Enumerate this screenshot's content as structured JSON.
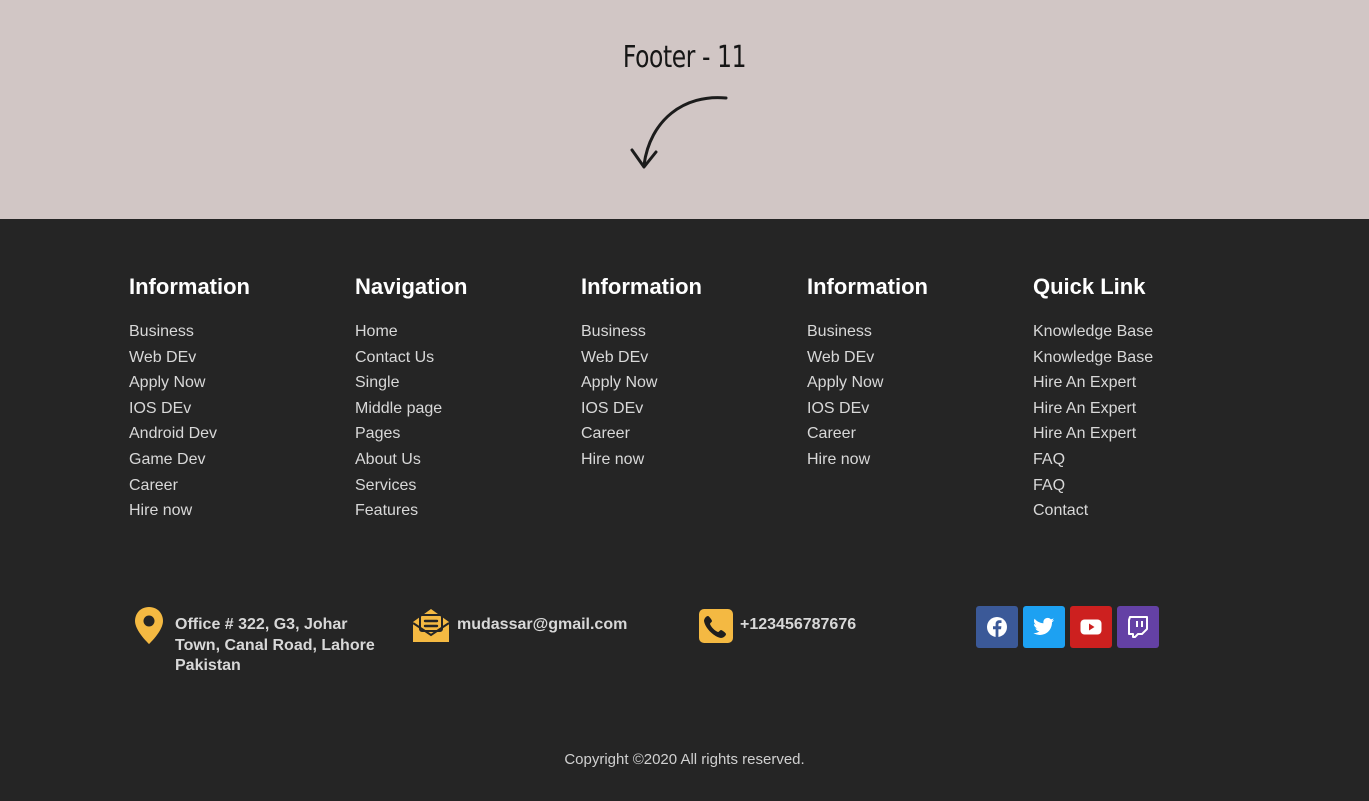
{
  "hero": {
    "title": "Footer - 11"
  },
  "columns": [
    {
      "title": "Information",
      "links": [
        "Business",
        "Web DEv",
        "Apply Now",
        "IOS DEv",
        "Android Dev",
        "Game Dev",
        "Career",
        "Hire now"
      ]
    },
    {
      "title": "Navigation",
      "links": [
        "Home",
        "Contact Us",
        "Single",
        "Middle page",
        "Pages",
        "About Us",
        "Services",
        "Features"
      ]
    },
    {
      "title": "Information",
      "links": [
        "Business",
        "Web DEv",
        "Apply Now",
        "IOS DEv",
        "Career",
        "Hire now"
      ]
    },
    {
      "title": "Information",
      "links": [
        "Business",
        "Web DEv",
        "Apply Now",
        "IOS DEv",
        "Career",
        "Hire now"
      ]
    },
    {
      "title": "Quick Link",
      "links": [
        "Knowledge Base",
        "Knowledge Base",
        "Hire An Expert",
        "Hire An Expert",
        "Hire An Expert",
        "FAQ",
        "FAQ",
        "Contact"
      ]
    }
  ],
  "contact": {
    "address": "Office # 322, G3, Johar Town, Canal Road, Lahore Pakistan",
    "email": "mudassar@gmail.com",
    "phone": "+123456787676"
  },
  "social": [
    {
      "name": "facebook-icon",
      "color": "#3b5998"
    },
    {
      "name": "twitter-icon",
      "color": "#1da1f2"
    },
    {
      "name": "youtube-icon",
      "color": "#cd201f"
    },
    {
      "name": "twitch-icon",
      "color": "#6441a5"
    }
  ],
  "colors": {
    "accent": "#f4b942",
    "hero_bg": "#d1c6c5",
    "footer_bg": "#252525"
  },
  "copyright": "Copyright ©2020 All rights reserved."
}
